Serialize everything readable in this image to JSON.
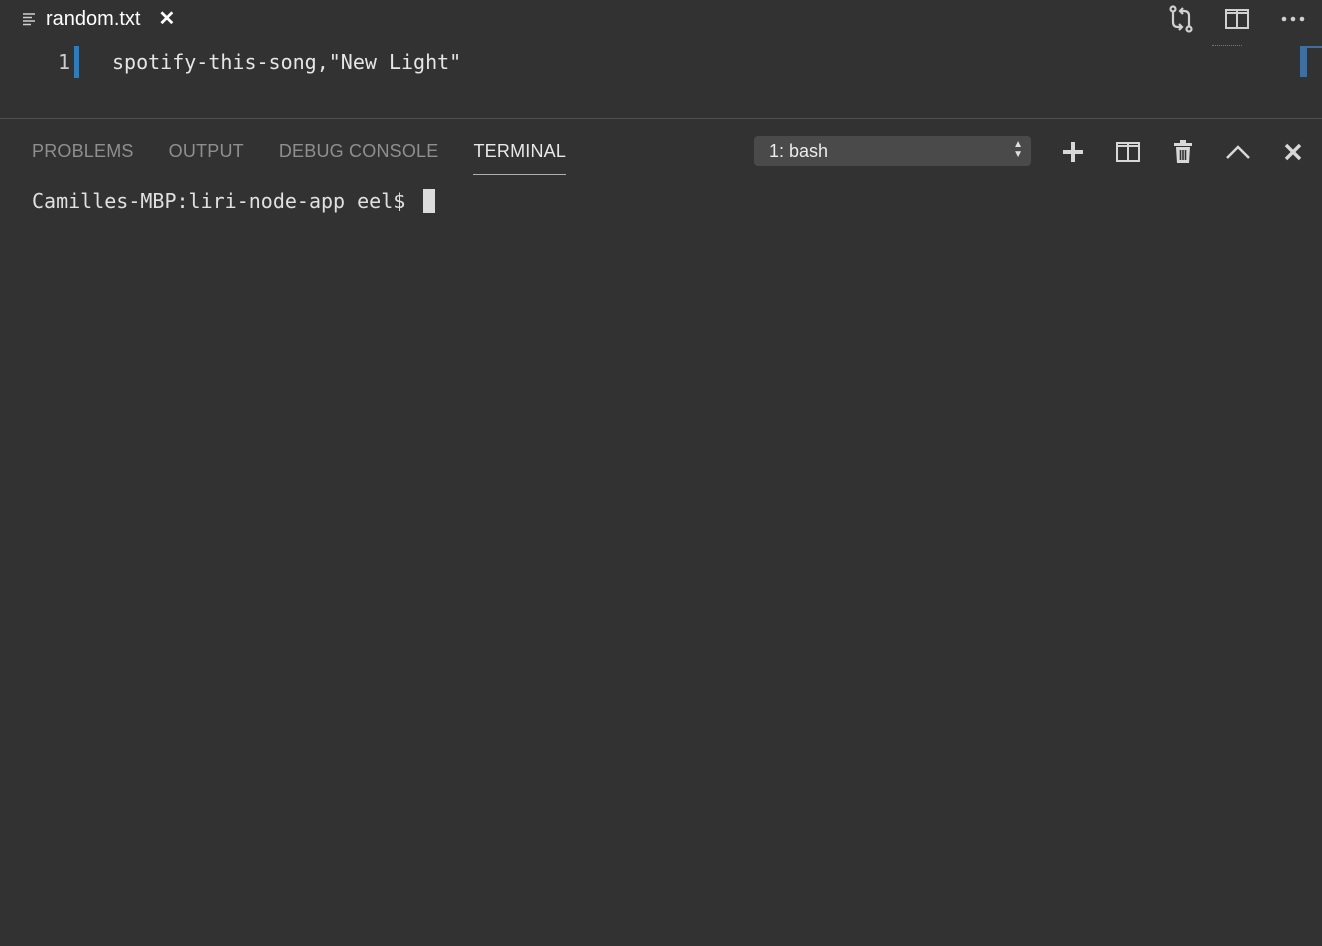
{
  "editor": {
    "tab": {
      "filename": "random.txt",
      "close_glyph": "✕"
    },
    "lines": [
      {
        "number": "1",
        "text": "spotify-this-song,\"New Light\""
      }
    ],
    "actions": [
      "git-compare-icon",
      "split-editor-icon",
      "more-actions-icon"
    ]
  },
  "panel": {
    "tabs": [
      {
        "label": "PROBLEMS",
        "active": false
      },
      {
        "label": "OUTPUT",
        "active": false
      },
      {
        "label": "DEBUG CONSOLE",
        "active": false
      },
      {
        "label": "TERMINAL",
        "active": true
      }
    ],
    "terminal_select": {
      "value": "1: bash"
    },
    "actions": [
      "plus-icon",
      "split-terminal-icon",
      "trash-icon",
      "chevron-up-icon",
      "close-icon"
    ],
    "terminal": {
      "prompt": "Camilles-MBP:liri-node-app eel$ "
    }
  },
  "colors": {
    "background": "#323232",
    "accent": "#2f7cb8"
  }
}
